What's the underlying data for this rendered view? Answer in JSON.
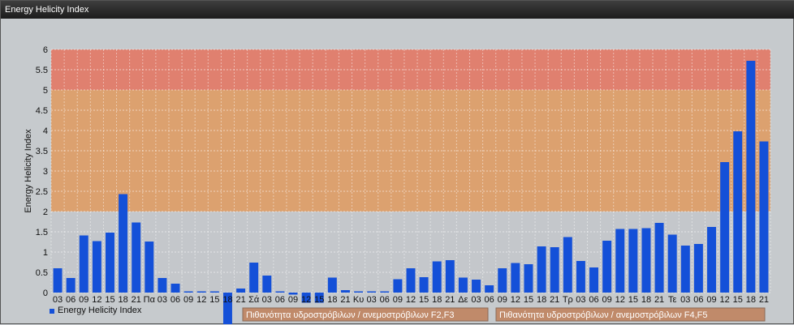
{
  "window": {
    "title": "Energy Helicity Index"
  },
  "legend": {
    "series_label": "Energy Helicity Index"
  },
  "bands": [
    {
      "label": "Πιθανότητα υδροστρόβιλων / ανεμοστρόβιλων F2,F3",
      "from": 2,
      "to": 5,
      "color": "#e09a5f"
    },
    {
      "label": "Πιθανότητα υδροστρόβιλων / ανεμοστρόβιλων F4,F5",
      "from": 5,
      "to": 6,
      "color": "#e5735f"
    }
  ],
  "colors": {
    "bar": "#1450d8",
    "plot_bg": "#c4c7cb",
    "band_box": "#c08a6a"
  },
  "chart_data": {
    "type": "bar",
    "title": "",
    "ylabel": "Energy Helicity Index",
    "xlabel": "",
    "ylim": [
      0,
      6
    ],
    "yticks": [
      0,
      0.5,
      1,
      1.5,
      2,
      2.5,
      3,
      3.5,
      4,
      4.5,
      5,
      5.5,
      6
    ],
    "grid": true,
    "legend_position": "bottom-left",
    "categories": [
      "03",
      "06",
      "09",
      "12",
      "15",
      "18",
      "21",
      "Πα",
      "03",
      "06",
      "09",
      "12",
      "15",
      "18",
      "21",
      "Σά",
      "03",
      "06",
      "09",
      "12",
      "15",
      "18",
      "21",
      "Κυ",
      "03",
      "06",
      "09",
      "12",
      "15",
      "18",
      "21",
      "Δε",
      "03",
      "06",
      "09",
      "12",
      "15",
      "18",
      "21",
      "Τρ",
      "03",
      "06",
      "09",
      "12",
      "15",
      "18",
      "21",
      "Τε",
      "03",
      "06",
      "09",
      "12",
      "15",
      "18",
      "21"
    ],
    "series": [
      {
        "values": [
          0.6,
          0.36,
          1.41,
          1.27,
          1.48,
          2.43,
          1.73,
          1.26,
          0.36,
          0.22,
          0.03,
          0.03,
          0.03,
          -0.78,
          0.1,
          0.74,
          0.42,
          0.03,
          -0.05,
          -0.25,
          -0.25,
          0.37,
          0.06,
          0.03,
          0.03,
          0.03,
          0.33,
          0.6,
          0.38,
          0.77,
          0.8,
          0.37,
          0.32,
          0.18,
          0.6,
          0.73,
          0.7,
          1.14,
          1.12,
          1.37,
          0.78,
          0.62,
          1.28,
          1.57,
          1.57,
          1.59,
          1.72,
          1.43,
          1.16,
          1.2,
          1.62,
          3.22,
          3.98,
          5.72,
          3.73
        ]
      }
    ]
  }
}
